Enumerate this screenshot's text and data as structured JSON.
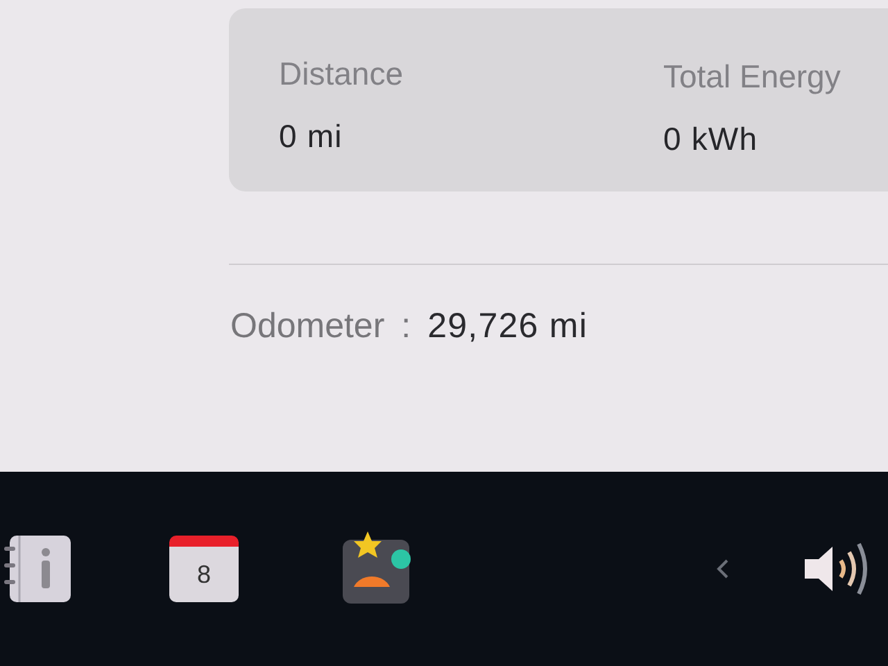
{
  "trip_stats": [
    {
      "label": "Distance",
      "value": "0 mi"
    },
    {
      "label": "Total Energy",
      "value": "0 kWh"
    }
  ],
  "odometer": {
    "label": "Odometer",
    "separator": ":",
    "value": "29,726 mi"
  },
  "taskbar": {
    "apps": [
      {
        "kind": "notebook"
      },
      {
        "kind": "calendar",
        "day": "8"
      },
      {
        "kind": "games"
      }
    ]
  }
}
